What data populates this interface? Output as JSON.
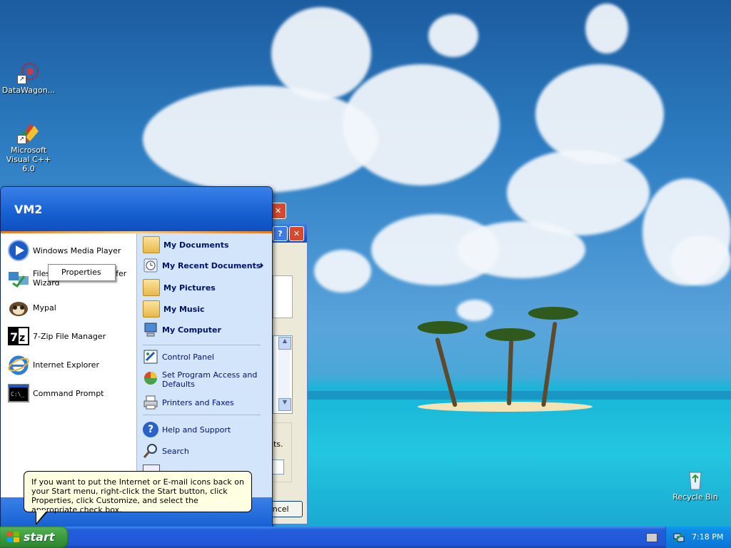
{
  "desktop": {
    "icons": [
      {
        "label": "DataWagon..."
      },
      {
        "label": "Microsoft Visual C++ 6.0"
      },
      {
        "label": "Recycle Bin"
      }
    ]
  },
  "background_windows": {
    "cancel_fragment": "ancel",
    "text_fragment": "nts."
  },
  "start_menu": {
    "user": "VM2",
    "pinned": [
      {
        "label": "Windows Media Player"
      },
      {
        "label": "Files and Settings Transfer Wizard",
        "visible_line1": "Files",
        "visible_line1_end": "fer",
        "visible_line2": "Wizard"
      },
      {
        "label": "Mypal"
      },
      {
        "label": "7-Zip File Manager"
      },
      {
        "label": "Internet Explorer"
      },
      {
        "label": "Command Prompt"
      }
    ],
    "places": [
      {
        "label": "My Documents"
      },
      {
        "label": "My Recent Documents"
      },
      {
        "label": "My Pictures"
      },
      {
        "label": "My Music"
      },
      {
        "label": "My Computer"
      }
    ],
    "settings": [
      {
        "label": "Control Panel"
      },
      {
        "label": "Set Program Access and Defaults",
        "line1": "Set Program Access and",
        "line2": "Defaults"
      },
      {
        "label": "Printers and Faxes"
      }
    ],
    "help": [
      {
        "label": "Help and Support"
      },
      {
        "label": "Search"
      }
    ]
  },
  "context_menu": {
    "items": [
      {
        "label": "Properties"
      }
    ]
  },
  "balloon": {
    "text": "If you want to put the Internet or E-mail icons back on your Start menu, right-click the Start button, click Properties, click Customize, and select the appropriate check box."
  },
  "taskbar": {
    "start_label": "start",
    "clock": "7:18 PM"
  },
  "colors": {
    "taskbar_blue": "#245edb",
    "start_green": "#3c9a3c",
    "menu_header_blue": "#1660d2",
    "places_panel": "#d3e5fa",
    "balloon_bg": "#ffffe1"
  }
}
